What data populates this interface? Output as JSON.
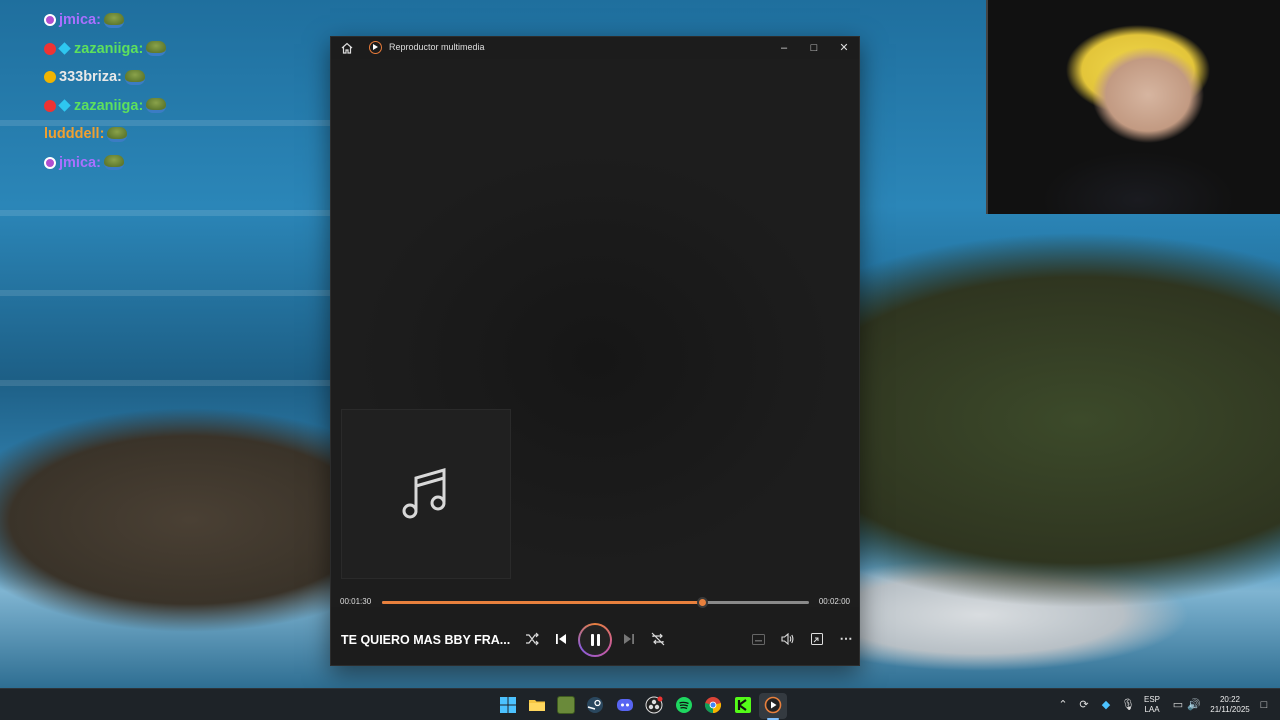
{
  "chat": {
    "messages": [
      {
        "user": "jmica",
        "color": "#a970ff",
        "badges": [
          "ring"
        ],
        "emote": "frog-emote"
      },
      {
        "user": "zazaniiga",
        "color": "#5de05d",
        "badges": [
          "red",
          "gem"
        ],
        "emote": "frog-emote"
      },
      {
        "user": "333briza",
        "color": "#e8e8e8",
        "badges": [
          "gold"
        ],
        "emote": "frog-emote"
      },
      {
        "user": "zazaniiga",
        "color": "#5de05d",
        "badges": [
          "red",
          "gem"
        ],
        "emote": "frog-emote"
      },
      {
        "user": "ludddell",
        "color": "#f0a030",
        "badges": [],
        "emote": "frog-emote"
      },
      {
        "user": "jmica",
        "color": "#a970ff",
        "badges": [
          "ring"
        ],
        "emote": "frog-emote"
      }
    ],
    "separator": ":"
  },
  "player": {
    "title": "Reproductor multimedia",
    "time_current": "00:01:30",
    "time_total": "00:02:00",
    "progress": 0.75,
    "song_title": "TE QUIERO MAS BBY FRA...",
    "accent": "#e8803d"
  },
  "taskbar": {
    "language_top": "ESP",
    "language_bottom": "LAA",
    "clock_time": "20:22",
    "clock_date": "21/11/2025"
  }
}
